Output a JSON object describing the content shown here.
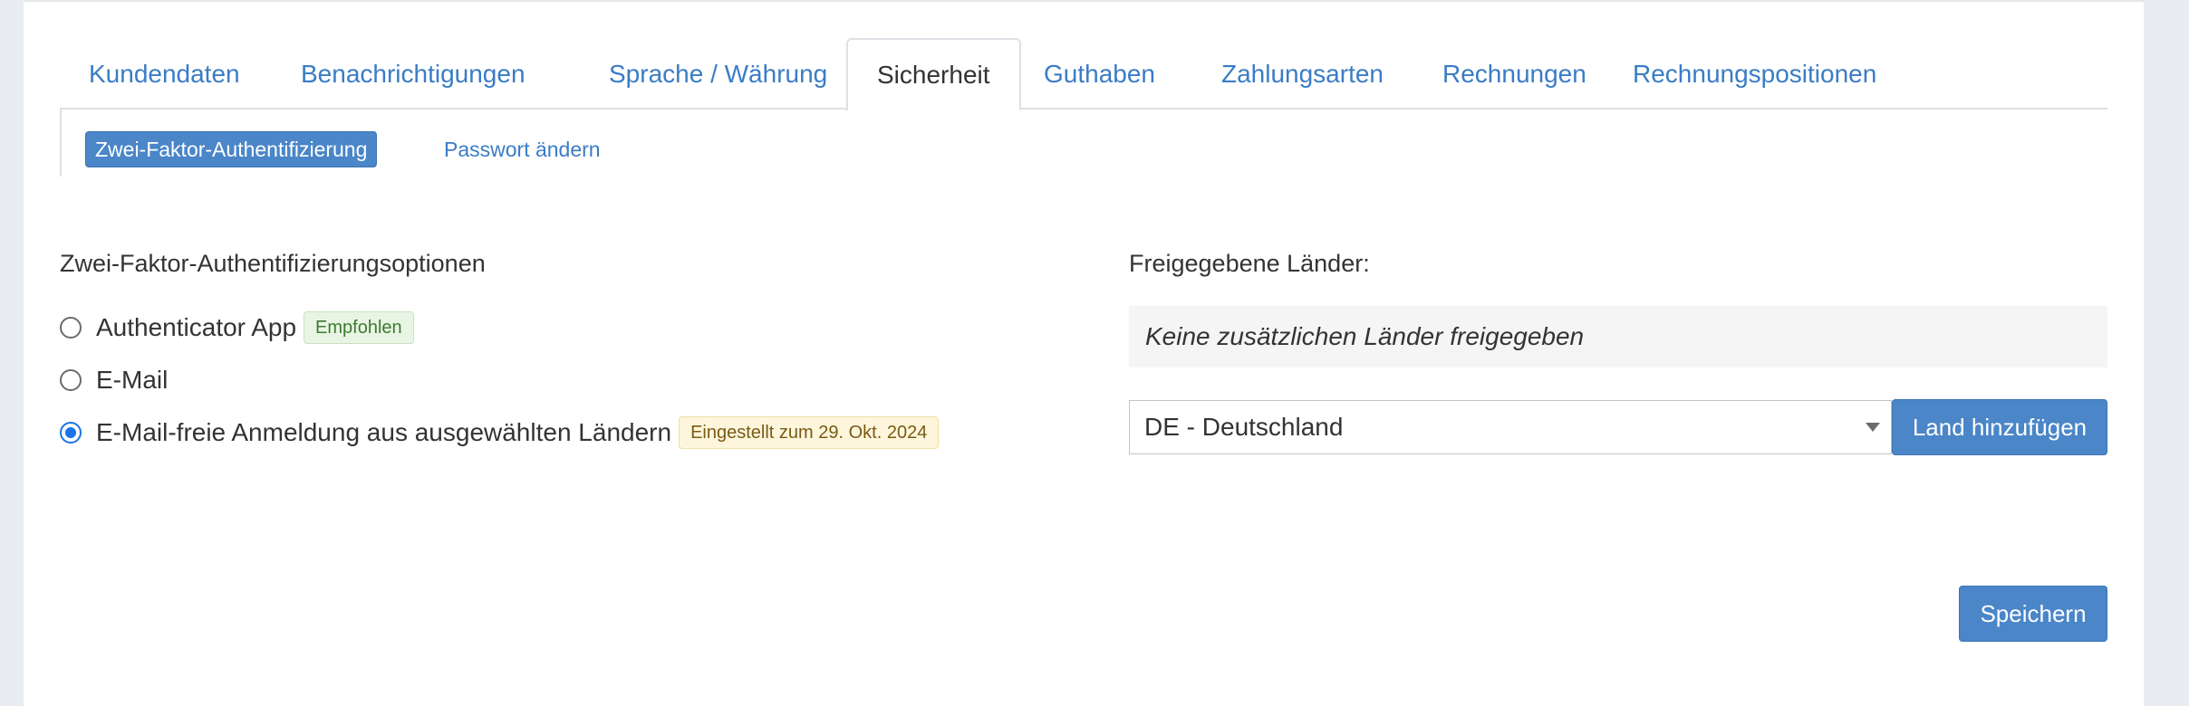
{
  "tabs": [
    {
      "label": "Kundendaten"
    },
    {
      "label": "Benachrichtigungen"
    },
    {
      "label": "Sprache / Währung"
    },
    {
      "label": "Sicherheit"
    },
    {
      "label": "Guthaben"
    },
    {
      "label": "Zahlungsarten"
    },
    {
      "label": "Rechnungen"
    },
    {
      "label": "Rechnungspositionen"
    }
  ],
  "active_tab": "Sicherheit",
  "subnav": {
    "active": "Zwei-Faktor-Authentifizierung",
    "link": "Passwort ändern"
  },
  "two_factor": {
    "title": "Zwei-Faktor-Authentifizierungsoptionen",
    "options": [
      {
        "label": "Authenticator App",
        "badge": "Empfohlen",
        "checked": false
      },
      {
        "label": "E-Mail",
        "checked": false
      },
      {
        "label": "E-Mail-freie Anmeldung aus ausgewählten Ländern",
        "badge": "Eingestellt zum 29. Okt. 2024",
        "checked": true
      }
    ]
  },
  "countries": {
    "title": "Freigegebene Länder:",
    "empty_text": "Keine zusätzlichen Länder freigegeben",
    "selected": "DE - Deutschland",
    "add_button": "Land hinzufügen"
  },
  "save_button": "Speichern",
  "colors": {
    "link": "#3a7cc6",
    "primary": "#4a86c8",
    "radio_checked": "#1a73e8"
  }
}
